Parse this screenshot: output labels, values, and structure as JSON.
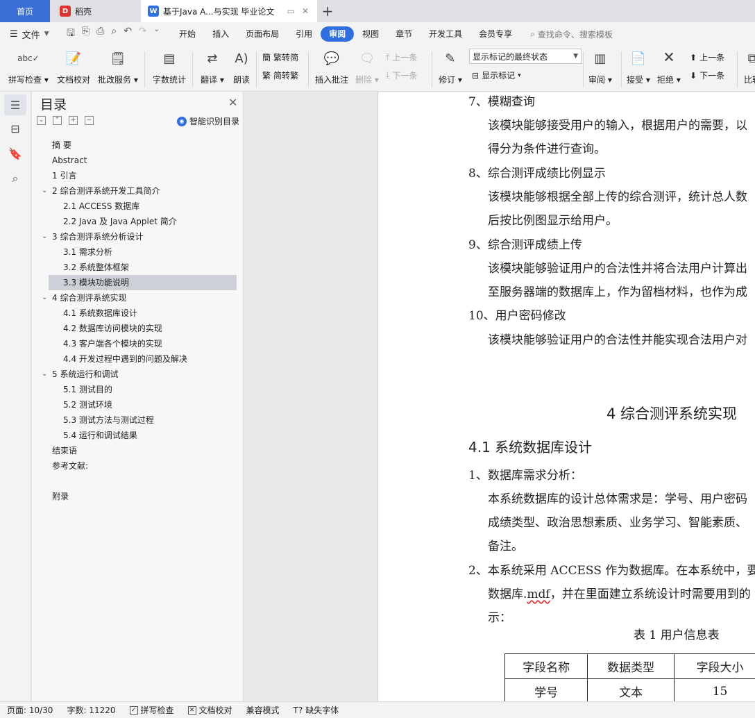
{
  "tabs": {
    "home": "首页",
    "daoke": "稻壳",
    "document": "基于Java A...与实现 毕业论文",
    "new_tab": "+"
  },
  "menu": {
    "file": "文件",
    "items": [
      "开始",
      "插入",
      "页面布局",
      "引用",
      "审阅",
      "视图",
      "章节",
      "开发工具",
      "会员专享"
    ],
    "active": "审阅",
    "search_placeholder": "查找命令、搜索模板"
  },
  "ribbon": {
    "spell_check": "拼写检查",
    "doc_proof": "文档校对",
    "review_service": "批改服务",
    "word_count": "字数统计",
    "translate": "翻译",
    "read_aloud": "朗读",
    "trad_to_simp": "繁转简",
    "simp_to_trad": "简转繁",
    "insert_comment": "插入批注",
    "delete": "删除",
    "prev_comment": "上一条",
    "next_comment": "下一条",
    "track_changes": "修订",
    "markup_mode": "显示标记的最终状态",
    "show_markup": "显示标记",
    "review": "审阅",
    "accept": "接受",
    "reject": "拒绝",
    "prev_change": "上一条",
    "next_change": "下一条",
    "compare": "比较"
  },
  "toc": {
    "title": "目录",
    "smart": "智能识别目录",
    "items": [
      {
        "text": "摘    要",
        "level": 1
      },
      {
        "text": "Abstract",
        "level": 1
      },
      {
        "text": "1  引言",
        "level": 1
      },
      {
        "text": "2  综合测评系统开发工具简介",
        "level": 1
      },
      {
        "text": "2.1    ACCESS 数据库",
        "level": 2
      },
      {
        "text": "2.2 Java 及 Java Applet 简介",
        "level": 2
      },
      {
        "text": "3  综合测评系统分析设计",
        "level": 1
      },
      {
        "text": "3.1 需求分析",
        "level": 2
      },
      {
        "text": "3.2 系统整体框架",
        "level": 2
      },
      {
        "text": "3.3 模块功能说明",
        "level": 2
      },
      {
        "text": "4  综合测评系统实现",
        "level": 1
      },
      {
        "text": "4.1 系统数据库设计",
        "level": 2
      },
      {
        "text": "4.2 数据库访问模块的实现",
        "level": 2
      },
      {
        "text": "4.3 客户端各个模块的实现",
        "level": 2
      },
      {
        "text": "4.4 开发过程中遇到的问题及解决",
        "level": 2
      },
      {
        "text": "5  系统运行和调试",
        "level": 1
      },
      {
        "text": "5.1 测试目的",
        "level": 2
      },
      {
        "text": "5.2 测试环境",
        "level": 2
      },
      {
        "text": "5.3 测试方法与测试过程",
        "level": 2
      },
      {
        "text": "5.4 运行和调试结果",
        "level": 2
      },
      {
        "text": "结束语",
        "level": 1
      },
      {
        "text": "参考文献:",
        "level": 1
      },
      {
        "text": "",
        "level": 1
      },
      {
        "text": "附录",
        "level": 1
      }
    ]
  },
  "document": {
    "lines": [
      "7、模糊查询",
      "该模块能够接受用户的输入，根据用户的需要，以",
      "得分为条件进行查询。",
      "8、综合测评成绩比例显示",
      "该模块能够根据全部上传的综合测评，统计总人数",
      "后按比例图显示给用户。",
      "9、综合测评成绩上传",
      "该模块能够验证用户的合法性并将合法用户计算出",
      "至服务器端的数据库上，作为留档材料，也作为成",
      "10、用户密码修改",
      "该模块能够验证用户的合法性并能实现合法用户对"
    ],
    "chapter": "4  综合测评系统实现",
    "section": "4.1 系统数据库设计",
    "lines2": [
      "1、数据库需求分析：",
      "本系统数据库的设计总体需求是：学号、用户密码",
      "成绩类型、政治思想素质、业务学习、智能素质、",
      "备注。",
      "2、本系统采用 ACCESS 作为数据库。在本系统中，要",
      "数据库.",
      "mdf",
      "，并在里面建立系统设计时需要用到的",
      "示："
    ],
    "table_caption": "表 1    用户信息表",
    "table": {
      "headers": [
        "字段名称",
        "数据类型",
        "字段大小"
      ],
      "rows": [
        [
          "学号",
          "文本",
          "15"
        ]
      ]
    }
  },
  "status": {
    "page": "页面: 10/30",
    "words": "字数: 11220",
    "spell": "拼写检查",
    "proof": "文档校对",
    "compat": "兼容模式",
    "missing_font": "缺失字体"
  }
}
